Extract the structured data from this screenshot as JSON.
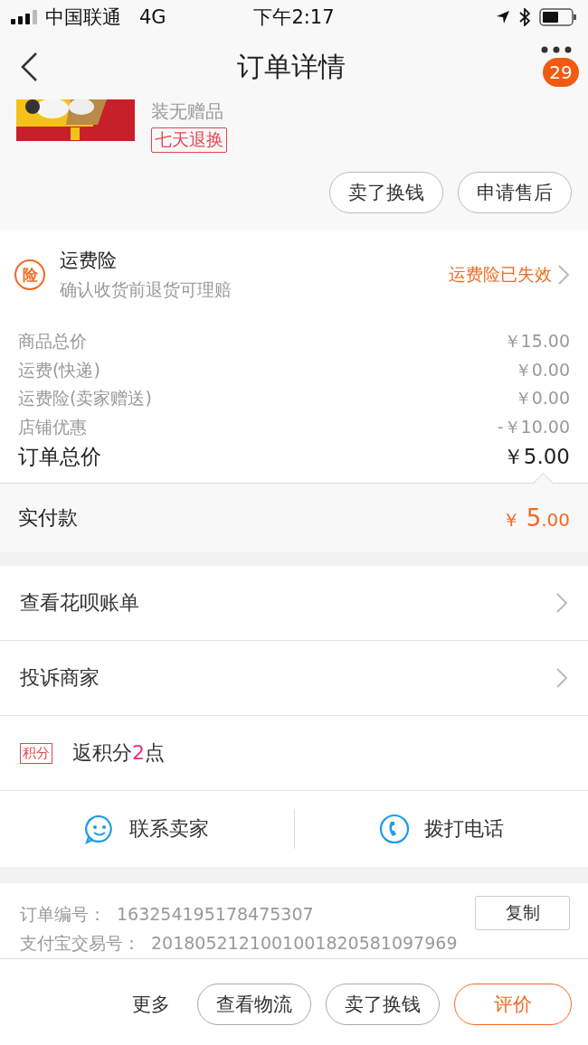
{
  "status_bar": {
    "carrier": "中国联通",
    "network": "4G",
    "time": "下午2:17"
  },
  "nav": {
    "title": "订单详情",
    "badge": "29"
  },
  "product": {
    "title": "装无赠品",
    "tag": "七天退换",
    "buttons": [
      "卖了换钱",
      "申请售后"
    ]
  },
  "insurance": {
    "icon": "险",
    "title": "运费险",
    "subtitle": "确认收货前退货可理赔",
    "status": "运费险已失效"
  },
  "price_lines": [
    {
      "label": "商品总价",
      "value": "￥15.00"
    },
    {
      "label": "运费(快递)",
      "value": "￥0.00"
    },
    {
      "label": "运费险(卖家赠送)",
      "value": "￥0.00"
    },
    {
      "label": "店铺优惠",
      "value": "-￥10.00"
    }
  ],
  "total": {
    "label": "订单总价",
    "value": "￥5.00"
  },
  "paid": {
    "label": "实付款",
    "currency": "￥",
    "amount": "5",
    "decimals": ".00"
  },
  "menu_rows": [
    {
      "label": "查看花呗账单"
    },
    {
      "label": "投诉商家"
    }
  ],
  "points": {
    "tag": "积分",
    "prefix": "返积分",
    "count": "2",
    "suffix": "点"
  },
  "contact": [
    {
      "kind": "chat",
      "label": "联系卖家"
    },
    {
      "kind": "phone",
      "label": "拨打电话"
    }
  ],
  "order_info": {
    "copy_button": "复制",
    "rows": [
      {
        "label": "订单编号：",
        "value": "163254195178475307"
      },
      {
        "label": "支付宝交易号：",
        "value": "2018052121001001820581097969"
      }
    ]
  },
  "actions": [
    {
      "kind": "text",
      "label": "更多"
    },
    {
      "kind": "outline",
      "label": "查看物流"
    },
    {
      "kind": "outline",
      "label": "卖了换钱"
    },
    {
      "kind": "primary",
      "label": "评价"
    }
  ]
}
